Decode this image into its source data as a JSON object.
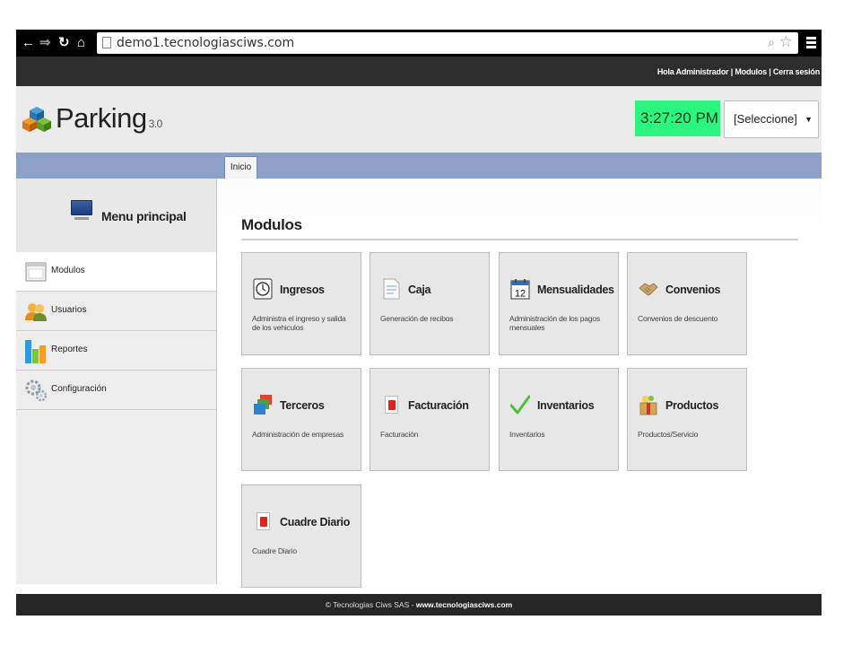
{
  "browser": {
    "url": "demo1.tecnologiasciws.com",
    "nav_icons": [
      "back-arrow-icon",
      "forward-arrow-icon",
      "reload-icon",
      "home-icon"
    ]
  },
  "topbar": {
    "greeting": "Hola Administrador",
    "modulos_link": "Modulos",
    "logout_link": "Cerra sesión",
    "separator": " | "
  },
  "header": {
    "brand": "Parking",
    "version": "3.0",
    "clock": "3:27:20 PM",
    "clock_color": "#2cf57f",
    "select_value": "[Seleccione]"
  },
  "tabs": [
    {
      "label": "Inicio"
    }
  ],
  "sidebar": {
    "title": "Menu principal",
    "items": [
      {
        "label": "Modulos",
        "icon": "window-icon",
        "active": true
      },
      {
        "label": "Usuarios",
        "icon": "users-icon"
      },
      {
        "label": "Reportes",
        "icon": "bar-chart-icon"
      },
      {
        "label": "Configuración",
        "icon": "gears-icon"
      }
    ]
  },
  "main": {
    "title": "Modulos",
    "modules": [
      {
        "title": "Ingresos",
        "desc": "Administra el ingreso y salida de los vehiculos",
        "icon": "clock-icon"
      },
      {
        "title": "Caja",
        "desc": "Generación de recibos",
        "icon": "document-icon"
      },
      {
        "title": "Mensualidades",
        "desc": "Administración de los pagos mensuales",
        "icon": "calendar-icon",
        "icon_text": "12"
      },
      {
        "title": "Convenios",
        "desc": "Convenios de descuento",
        "icon": "handshake-icon"
      },
      {
        "title": "Terceros",
        "desc": "Administración de empresas",
        "icon": "stacked-windows-icon"
      },
      {
        "title": "Facturación",
        "desc": "Facturación",
        "icon": "red-document-icon"
      },
      {
        "title": "Inventarios",
        "desc": "Inventarios",
        "icon": "checkmark-icon"
      },
      {
        "title": "Productos",
        "desc": "Productos/Servicio",
        "icon": "gift-box-icon"
      },
      {
        "title": "Cuadre Diario",
        "desc": "Cuadre Diario",
        "icon": "red-document-icon"
      }
    ]
  },
  "footer": {
    "text": "© Tecnologias Ciws SAS - ",
    "link": "www.tecnologiasciws.com"
  }
}
